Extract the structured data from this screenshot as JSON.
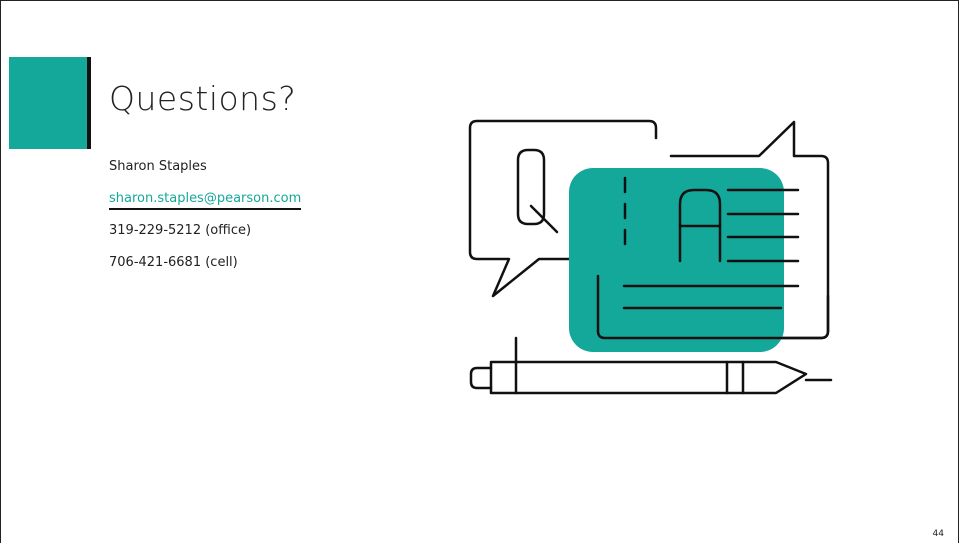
{
  "slide": {
    "title": "Questions?",
    "contact": {
      "name": "Sharon Staples",
      "email": "sharon.staples@pearson.com",
      "office_phone": "319-229-5212 (office)",
      "cell_phone": "706-421-6681 (cell)"
    },
    "illustration": {
      "icon": "qa-speech-bubbles-pen-icon",
      "question_letter": "Q",
      "answer_letter": "A"
    },
    "page_number": "44"
  },
  "colors": {
    "accent": "#14a89a",
    "stroke": "#111111",
    "text": "#222222"
  }
}
